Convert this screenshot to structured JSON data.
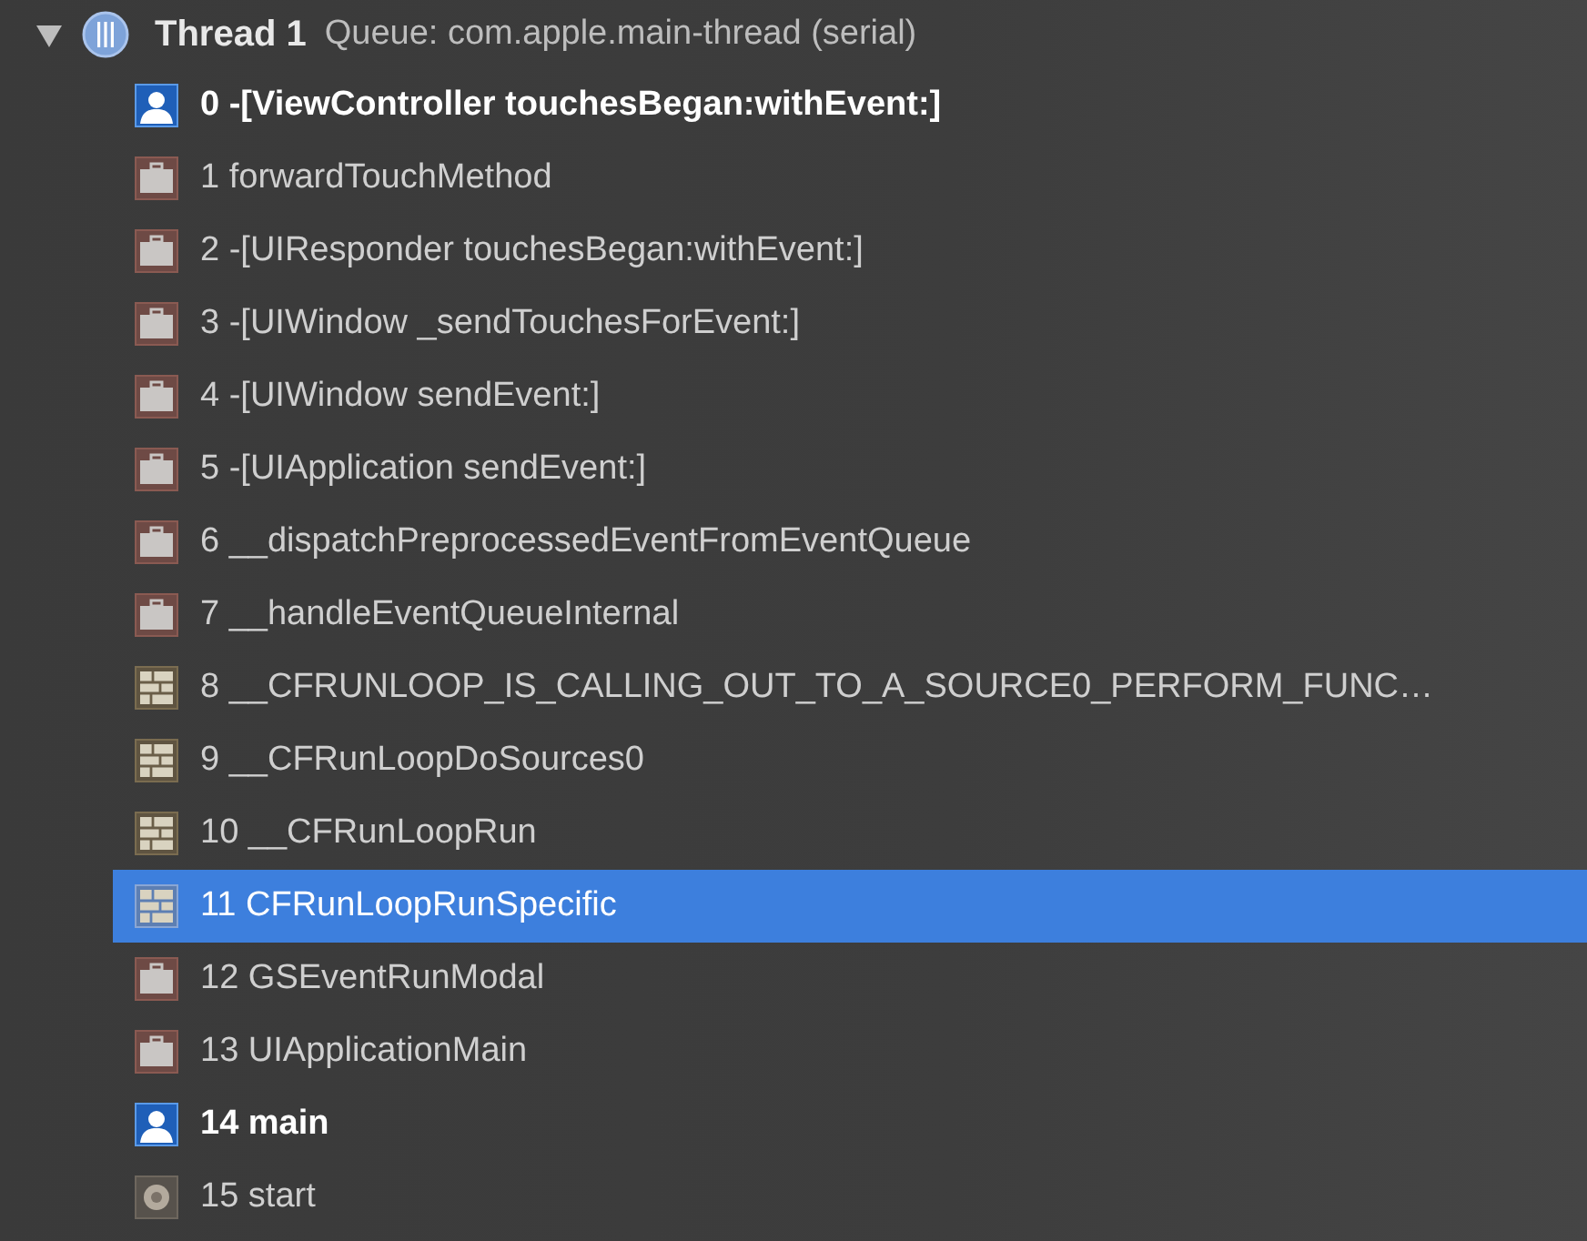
{
  "thread": {
    "expanded": true,
    "title": "Thread 1",
    "queue": "Queue: com.apple.main-thread (serial)"
  },
  "frames": [
    {
      "kind": "user",
      "label": "0 -[ViewController touchesBegan:withEvent:]",
      "selected": false
    },
    {
      "kind": "library",
      "label": "1 forwardTouchMethod",
      "selected": false
    },
    {
      "kind": "library",
      "label": "2 -[UIResponder touchesBegan:withEvent:]",
      "selected": false
    },
    {
      "kind": "library",
      "label": "3 -[UIWindow _sendTouchesForEvent:]",
      "selected": false
    },
    {
      "kind": "library",
      "label": "4 -[UIWindow sendEvent:]",
      "selected": false
    },
    {
      "kind": "library",
      "label": "5 -[UIApplication sendEvent:]",
      "selected": false
    },
    {
      "kind": "library",
      "label": "6 __dispatchPreprocessedEventFromEventQueue",
      "selected": false
    },
    {
      "kind": "library",
      "label": "7 __handleEventQueueInternal",
      "selected": false
    },
    {
      "kind": "framework",
      "label": "8 __CFRUNLOOP_IS_CALLING_OUT_TO_A_SOURCE0_PERFORM_FUNC…",
      "selected": false
    },
    {
      "kind": "framework",
      "label": "9 __CFRunLoopDoSources0",
      "selected": false
    },
    {
      "kind": "framework",
      "label": "10 __CFRunLoopRun",
      "selected": false
    },
    {
      "kind": "framework",
      "label": "11 CFRunLoopRunSpecific",
      "selected": true
    },
    {
      "kind": "library",
      "label": "12 GSEventRunModal",
      "selected": false
    },
    {
      "kind": "library",
      "label": "13 UIApplicationMain",
      "selected": false
    },
    {
      "kind": "user",
      "label": "14 main",
      "selected": false
    },
    {
      "kind": "system",
      "label": "15 start",
      "selected": false
    }
  ]
}
